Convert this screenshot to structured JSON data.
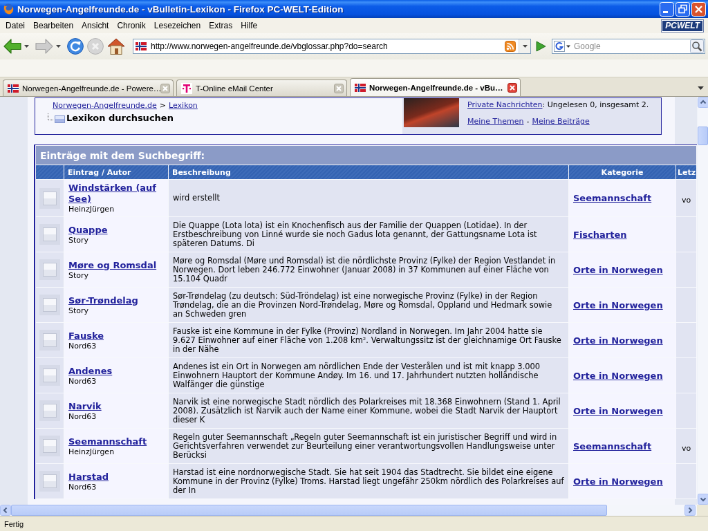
{
  "window": {
    "title": "Norwegen-Angelfreunde.de - vBulletin-Lexikon - Firefox PC-WELT-Edition"
  },
  "menu_bar": {
    "items": [
      "Datei",
      "Bearbeiten",
      "Ansicht",
      "Chronik",
      "Lesezeichen",
      "Extras",
      "Hilfe"
    ],
    "logo": "PCWELT"
  },
  "nav_buttons": [
    {
      "kind": "back",
      "disabled": false
    },
    {
      "kind": "forward",
      "disabled": true
    },
    {
      "kind": "reload",
      "disabled": false
    },
    {
      "kind": "stop",
      "disabled": true
    },
    {
      "kind": "home",
      "disabled": false
    }
  ],
  "address_bar": {
    "url": "http://www.norwegen-angelfreunde.de/vbglossar.php?do=search"
  },
  "search_bar": {
    "placeholder": "Google"
  },
  "tabs": [
    {
      "label": "Norwegen-Angelfreunde.de - Powere…",
      "kind": "forum",
      "selected": false
    },
    {
      "label": "T-Online eMail Center",
      "kind": "mail",
      "selected": false
    },
    {
      "label": "Norwegen-Angelfreunde.de - vBu…",
      "kind": "forum",
      "selected": true
    }
  ],
  "header": {
    "breadcrumb": {
      "links": [
        "Norwegen-Angelfreunde.de",
        "Lexikon"
      ],
      "separator": ">"
    },
    "current_page": "Lexikon durchsuchen",
    "user_panel": {
      "messages_link": "Private Nachrichten",
      "messages_status": ": Ungelesen 0, insgesamt 2.",
      "links": [
        "Meine Themen",
        "Meine Beiträge"
      ],
      "separator": "-"
    }
  },
  "results": {
    "title": "Einträge mit dem Suchbegriff:",
    "columns": [
      "Eintrag / Autor",
      "Beschreibung",
      "Kategorie",
      "Letz"
    ],
    "rows": [
      {
        "entry": "Windstärken (auf See)",
        "author": "HeinzJürgen",
        "description": "wird erstellt",
        "category": "Seemannschaft",
        "column_5": "vo"
      },
      {
        "entry": "Quappe",
        "author": "Story",
        "description": "Die Quappe (Lota lota) ist ein Knochenfisch aus der Familie der Quappen (Lotidae). In der Erstbeschreibung von Linné wurde sie noch Gadus lota genannt, der Gattungsname Lota ist späteren Datums. Di",
        "category": "Fischarten"
      },
      {
        "entry": "Møre og Romsdal",
        "author": "Story",
        "description": "Møre og Romsdal (Møre und Romsdal) ist die nördlichste Provinz (Fylke) der Region Vestlandet in Norwegen. Dort leben 246.772 Einwohner (Januar 2008) in 37 Kommunen auf einer Fläche von 15.104 Quadr",
        "category": "Orte in Norwegen"
      },
      {
        "entry": "Sør-Trøndelag",
        "author": "Story",
        "description": "Sør-Trøndelag (zu deutsch: Süd-Tröndelag) ist eine norwegische Provinz (Fylke) in der Region Trøndelag, die an die Provinzen Nord-Trøndelag, Møre og Romsdal, Oppland und Hedmark sowie an Schweden gren",
        "category": "Orte in Norwegen"
      },
      {
        "entry": "Fauske",
        "author": "Nord63",
        "description": "Fauske ist eine Kommune in der Fylke (Provinz) Nordland in Norwegen. Im Jahr 2004 hatte sie 9.627 Einwohner auf einer Fläche von 1.208 km². Verwaltungssitz ist der gleichnamige Ort Fauske in der Nähe",
        "category": "Orte in Norwegen"
      },
      {
        "entry": "Andenes",
        "author": "Nord63",
        "description": "Andenes ist ein Ort in Norwegen am nördlichen Ende der Vesterålen und ist mit knapp 3.000 Einwohnern Hauptort der Kommune Andøy. Im 16. und 17. Jahrhundert nutzten holländische Walfänger die günstige",
        "category": "Orte in Norwegen"
      },
      {
        "entry": "Narvik",
        "author": "Nord63",
        "description": "Narvik ist eine norwegische Stadt nördlich des Polarkreises mit 18.368 Einwohnern (Stand 1. April 2008). Zusätzlich ist Narvik auch der Name einer Kommune, wobei die Stadt Narvik der Hauptort dieser K",
        "category": "Orte in Norwegen"
      },
      {
        "entry": "Seemannschaft",
        "author": "HeinzJürgen",
        "description": "Regeln guter Seemannschaft „Regeln guter Seemannschaft ist ein juristischer Begriff und wird in Gerichtsverfahren verwendet zur Beurteilung einer verantwortungsvollen Handlungsweise unter Berücksi",
        "category": "Seemannschaft",
        "column_5": "vo"
      },
      {
        "entry": "Harstad",
        "author": "Nord63",
        "description": "Harstad ist eine nordnorwegische Stadt. Sie hat seit 1904 das Stadtrecht. Sie bildet eine eigene Kommune in der Provinz (Fylke) Troms. Harstad liegt ungefähr 250km nördlich des Polarkreises auf der In",
        "category": "Orte in Norwegen"
      }
    ]
  },
  "status_bar": {
    "text": "Fertig"
  }
}
